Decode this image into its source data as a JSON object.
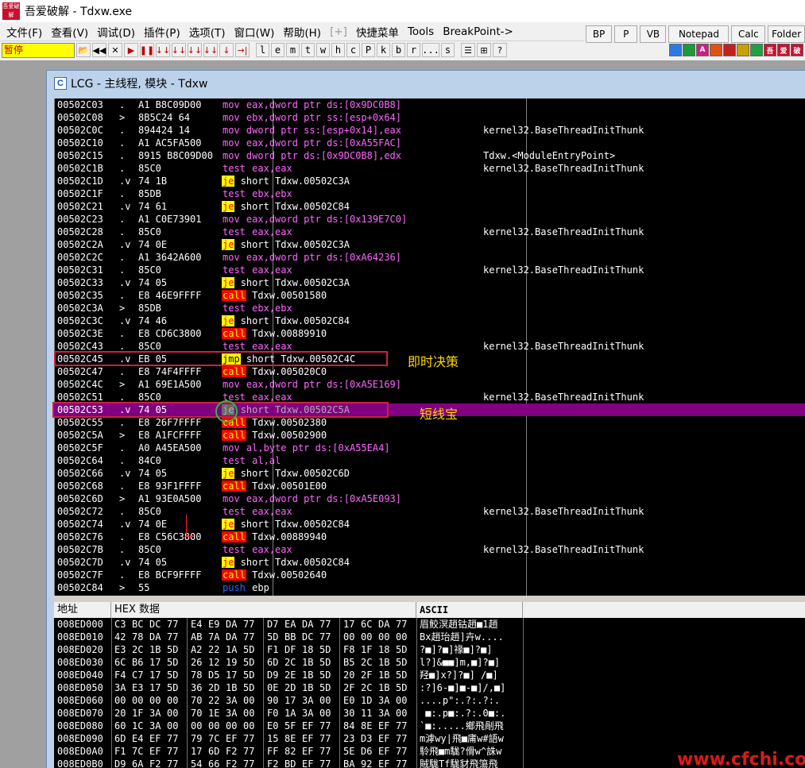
{
  "window": {
    "logo_text": "吾爱破解",
    "title": "吾爱破解 - Tdxw.exe"
  },
  "menu": [
    "文件(F)",
    "查看(V)",
    "调试(D)",
    "插件(P)",
    "选项(T)",
    "窗口(W)",
    "帮助(H)",
    "[+]",
    "快捷菜单",
    "Tools",
    "BreakPoint->"
  ],
  "quick_buttons": [
    "BP",
    "P",
    "VB",
    "Notepad",
    "Calc",
    "Folder"
  ],
  "toolbar": {
    "status": "暂停",
    "buttons": [
      "📂",
      "◀◀",
      "✕",
      "▶",
      "❚❚",
      "↓↓",
      "↓↓",
      "↓↓",
      "↓↓",
      "↓",
      "→|"
    ],
    "letters": [
      "l",
      "e",
      "m",
      "t",
      "w",
      "h",
      "c",
      "P",
      "k",
      "b",
      "r",
      "...",
      "s"
    ],
    "extra": [
      "☰",
      "⊞",
      "?"
    ],
    "color_buttons": [
      {
        "label": "",
        "color": "#2a7be0"
      },
      {
        "label": "",
        "color": "#1a9a3a"
      },
      {
        "label": "A",
        "color": "#cc2080"
      },
      {
        "label": "",
        "color": "#e05010"
      },
      {
        "label": "",
        "color": "#c02020"
      },
      {
        "label": "",
        "color": "#c8a000"
      },
      {
        "label": "",
        "color": "#20a040"
      },
      {
        "label": "吾",
        "color": "#c8102e"
      },
      {
        "label": "爱",
        "color": "#c8102e"
      },
      {
        "label": "破",
        "color": "#c8102e"
      }
    ]
  },
  "child_window": {
    "icon": "C",
    "title": "LCG - 主线程, 模块 - Tdxw"
  },
  "disasm": [
    {
      "addr": "00502C03",
      "mark": ".",
      "hex": "A1 B8C09D00",
      "op": "mov",
      "args": "eax,dword ptr ds:[0x9DC0B8]",
      "mem": true,
      "cmt": ""
    },
    {
      "addr": "00502C08",
      "mark": ">",
      "hex": "8B5C24 64",
      "op": "mov",
      "args": "ebx,dword ptr ss:[esp+0x64]",
      "mem": true,
      "cmt": ""
    },
    {
      "addr": "00502C0C",
      "mark": ".",
      "hex": "894424 14",
      "op": "mov",
      "args": "dword ptr ss:[esp+0x14],eax",
      "mem": true,
      "cmt": "kernel32.BaseThreadInitThunk"
    },
    {
      "addr": "00502C10",
      "mark": ".",
      "hex": "A1 AC5FA500",
      "op": "mov",
      "args": "eax,dword ptr ds:[0xA55FAC]",
      "mem": true,
      "cmt": ""
    },
    {
      "addr": "00502C15",
      "mark": ".",
      "hex": "8915 B8C09D00",
      "op": "mov",
      "args": "dword ptr ds:[0x9DC0B8],edx",
      "mem": true,
      "cmt": "Tdxw.<ModuleEntryPoint>"
    },
    {
      "addr": "00502C1B",
      "mark": ".",
      "hex": "85C0",
      "op": "test",
      "args": "eax,eax",
      "mem": true,
      "cmt": "kernel32.BaseThreadInitThunk"
    },
    {
      "addr": "00502C1D",
      "mark": ".v",
      "hex": "74 1B",
      "op": "je",
      "args": "short Tdxw.00502C3A",
      "mem": false,
      "cmt": ""
    },
    {
      "addr": "00502C1F",
      "mark": ".",
      "hex": "85DB",
      "op": "test",
      "args": "ebx,ebx",
      "mem": true,
      "cmt": ""
    },
    {
      "addr": "00502C21",
      "mark": ".v",
      "hex": "74 61",
      "op": "je",
      "args": "short Tdxw.00502C84",
      "mem": false,
      "cmt": ""
    },
    {
      "addr": "00502C23",
      "mark": ".",
      "hex": "A1 C0E73901",
      "op": "mov",
      "args": "eax,dword ptr ds:[0x139E7C0]",
      "mem": true,
      "cmt": ""
    },
    {
      "addr": "00502C28",
      "mark": ".",
      "hex": "85C0",
      "op": "test",
      "args": "eax,eax",
      "mem": true,
      "cmt": "kernel32.BaseThreadInitThunk"
    },
    {
      "addr": "00502C2A",
      "mark": ".v",
      "hex": "74 0E",
      "op": "je",
      "args": "short Tdxw.00502C3A",
      "mem": false,
      "cmt": ""
    },
    {
      "addr": "00502C2C",
      "mark": ".",
      "hex": "A1 3642A600",
      "op": "mov",
      "args": "eax,dword ptr ds:[0xA64236]",
      "mem": true,
      "cmt": ""
    },
    {
      "addr": "00502C31",
      "mark": ".",
      "hex": "85C0",
      "op": "test",
      "args": "eax,eax",
      "mem": true,
      "cmt": "kernel32.BaseThreadInitThunk"
    },
    {
      "addr": "00502C33",
      "mark": ".v",
      "hex": "74 05",
      "op": "je",
      "args": "short Tdxw.00502C3A",
      "mem": false,
      "cmt": ""
    },
    {
      "addr": "00502C35",
      "mark": ".",
      "hex": "E8 46E9FFFF",
      "op": "call",
      "args": "Tdxw.00501580",
      "mem": false,
      "cmt": ""
    },
    {
      "addr": "00502C3A",
      "mark": ">",
      "hex": "85DB",
      "op": "test",
      "args": "ebx,ebx",
      "mem": true,
      "cmt": ""
    },
    {
      "addr": "00502C3C",
      "mark": ".v",
      "hex": "74 46",
      "op": "je",
      "args": "short Tdxw.00502C84",
      "mem": false,
      "cmt": ""
    },
    {
      "addr": "00502C3E",
      "mark": ".",
      "hex": "E8 CD6C3800",
      "op": "call",
      "args": "Tdxw.00889910",
      "mem": false,
      "cmt": ""
    },
    {
      "addr": "00502C43",
      "mark": ".",
      "hex": "85C0",
      "op": "test",
      "args": "eax,eax",
      "mem": true,
      "cmt": "kernel32.BaseThreadInitThunk"
    },
    {
      "addr": "00502C45",
      "mark": ".v",
      "hex": "EB 05",
      "op": "jmp",
      "args": "short Tdxw.00502C4C",
      "mem": false,
      "cmt": ""
    },
    {
      "addr": "00502C47",
      "mark": ".",
      "hex": "E8 74F4FFFF",
      "op": "call",
      "args": "Tdxw.005020C0",
      "mem": false,
      "cmt": ""
    },
    {
      "addr": "00502C4C",
      "mark": ">",
      "hex": "A1 69E1A500",
      "op": "mov",
      "args": "eax,dword ptr ds:[0xA5E169]",
      "mem": true,
      "cmt": ""
    },
    {
      "addr": "00502C51",
      "mark": ".",
      "hex": "85C0",
      "op": "test",
      "args": "eax,eax",
      "mem": true,
      "cmt": "kernel32.BaseThreadInitThunk"
    },
    {
      "addr": "00502C53",
      "mark": ".v",
      "hex": "74 05",
      "op": "je",
      "args": "short Tdxw.00502C5A",
      "mem": false,
      "cmt": ""
    },
    {
      "addr": "00502C55",
      "mark": ".",
      "hex": "E8 26F7FFFF",
      "op": "call",
      "args": "Tdxw.00502380",
      "mem": false,
      "cmt": ""
    },
    {
      "addr": "00502C5A",
      "mark": ">",
      "hex": "E8 A1FCFFFF",
      "op": "call",
      "args": "Tdxw.00502900",
      "mem": false,
      "cmt": ""
    },
    {
      "addr": "00502C5F",
      "mark": ".",
      "hex": "A0 A45EA500",
      "op": "mov",
      "args": "al,byte ptr ds:[0xA55EA4]",
      "mem": true,
      "cmt": ""
    },
    {
      "addr": "00502C64",
      "mark": ".",
      "hex": "84C0",
      "op": "test",
      "args": "al,al",
      "mem": true,
      "cmt": ""
    },
    {
      "addr": "00502C66",
      "mark": ".v",
      "hex": "74 05",
      "op": "je",
      "args": "short Tdxw.00502C6D",
      "mem": false,
      "cmt": ""
    },
    {
      "addr": "00502C68",
      "mark": ".",
      "hex": "E8 93F1FFFF",
      "op": "call",
      "args": "Tdxw.00501E00",
      "mem": false,
      "cmt": ""
    },
    {
      "addr": "00502C6D",
      "mark": ">",
      "hex": "A1 93E0A500",
      "op": "mov",
      "args": "eax,dword ptr ds:[0xA5E093]",
      "mem": true,
      "cmt": ""
    },
    {
      "addr": "00502C72",
      "mark": ".",
      "hex": "85C0",
      "op": "test",
      "args": "eax,eax",
      "mem": true,
      "cmt": "kernel32.BaseThreadInitThunk"
    },
    {
      "addr": "00502C74",
      "mark": ".v",
      "hex": "74 0E",
      "op": "je",
      "args": "short Tdxw.00502C84",
      "mem": false,
      "cmt": ""
    },
    {
      "addr": "00502C76",
      "mark": ".",
      "hex": "E8 C56C3800",
      "op": "call",
      "args": "Tdxw.00889940",
      "mem": false,
      "cmt": ""
    },
    {
      "addr": "00502C7B",
      "mark": ".",
      "hex": "85C0",
      "op": "test",
      "args": "eax,eax",
      "mem": true,
      "cmt": "kernel32.BaseThreadInitThunk"
    },
    {
      "addr": "00502C7D",
      "mark": ".v",
      "hex": "74 05",
      "op": "je",
      "args": "short Tdxw.00502C84",
      "mem": false,
      "cmt": ""
    },
    {
      "addr": "00502C7F",
      "mark": ".",
      "hex": "E8 BCF9FFFF",
      "op": "call",
      "args": "Tdxw.00502640",
      "mem": false,
      "cmt": ""
    },
    {
      "addr": "00502C84",
      "mark": ">",
      "hex": "55",
      "op": "push",
      "args": "ebp",
      "mem": false,
      "cmt": ""
    }
  ],
  "selected_addr": "00502C53",
  "annotations": {
    "jmp_note": "即时决策",
    "je_note": "短线宝"
  },
  "dump_headers": [
    "地址",
    "HEX 数据",
    "ASCII"
  ],
  "dump": [
    {
      "addr": "008ED000",
      "bytes": [
        "C3",
        "BC",
        "DC",
        "77",
        "E4",
        "E9",
        "DA",
        "77",
        "D7",
        "EA",
        "DA",
        "77",
        "17",
        "6C",
        "DA",
        "77"
      ],
      "ascii": "眉鲛溟趙钴趙■1趙"
    },
    {
      "addr": "008ED010",
      "bytes": [
        "42",
        "78",
        "DA",
        "77",
        "AB",
        "7A",
        "DA",
        "77",
        "5D",
        "BB",
        "DC",
        "77",
        "00",
        "00",
        "00",
        "00"
      ],
      "ascii": "Bx趙珆趙]卉w...."
    },
    {
      "addr": "008ED020",
      "bytes": [
        "E3",
        "2C",
        "1B",
        "5D",
        "A2",
        "22",
        "1A",
        "5D",
        "F1",
        "DF",
        "18",
        "5D",
        "F8",
        "1F",
        "18",
        "5D"
      ],
      "ascii": "?■]?■]禒■]?■]"
    },
    {
      "addr": "008ED030",
      "bytes": [
        "6C",
        "B6",
        "17",
        "5D",
        "26",
        "12",
        "19",
        "5D",
        "6D",
        "2C",
        "1B",
        "5D",
        "B5",
        "2C",
        "1B",
        "5D"
      ],
      "ascii": "l?]&■■]m,■]?■]"
    },
    {
      "addr": "008ED040",
      "bytes": [
        "F4",
        "C7",
        "17",
        "5D",
        "78",
        "D5",
        "17",
        "5D",
        "D9",
        "2E",
        "1B",
        "5D",
        "20",
        "2F",
        "1B",
        "5D"
      ],
      "ascii": "羟■]x?]?■] /■]"
    },
    {
      "addr": "008ED050",
      "bytes": [
        "3A",
        "E3",
        "17",
        "5D",
        "36",
        "2D",
        "1B",
        "5D",
        "0E",
        "2D",
        "1B",
        "5D",
        "2F",
        "2C",
        "1B",
        "5D"
      ],
      "ascii": ":?]6-■]■-■]/,■]"
    },
    {
      "addr": "008ED060",
      "bytes": [
        "00",
        "00",
        "00",
        "00",
        "70",
        "22",
        "3A",
        "00",
        "90",
        "17",
        "3A",
        "00",
        "E0",
        "1D",
        "3A",
        "00"
      ],
      "ascii": "....p\":.?:.?:."
    },
    {
      "addr": "008ED070",
      "bytes": [
        "20",
        "1F",
        "3A",
        "00",
        "70",
        "1E",
        "3A",
        "00",
        "F0",
        "1A",
        "3A",
        "00",
        "30",
        "11",
        "3A",
        "00"
      ],
      "ascii": " ■:.p■:.?:.0■:."
    },
    {
      "addr": "008ED080",
      "bytes": [
        "60",
        "1C",
        "3A",
        "00",
        "00",
        "00",
        "00",
        "00",
        "E0",
        "5F",
        "EF",
        "77",
        "84",
        "8E",
        "EF",
        "77"
      ],
      "ascii": "`■:.....鄉飛剮飛"
    },
    {
      "addr": "008ED090",
      "bytes": [
        "6D",
        "E4",
        "EF",
        "77",
        "79",
        "7C",
        "EF",
        "77",
        "15",
        "8E",
        "EF",
        "77",
        "23",
        "D3",
        "EF",
        "77"
      ],
      "ascii": "m滹wy|飛■庯w#語w"
    },
    {
      "addr": "008ED0A0",
      "bytes": [
        "F1",
        "7C",
        "EF",
        "77",
        "17",
        "6D",
        "F2",
        "77",
        "FF",
        "82",
        "EF",
        "77",
        "5E",
        "D6",
        "EF",
        "77"
      ],
      "ascii": "駖飛■m駹?傦w^誅w"
    },
    {
      "addr": "008ED0B0",
      "bytes": [
        "D9",
        "6A",
        "F2",
        "77",
        "54",
        "66",
        "F2",
        "77",
        "F2",
        "BD",
        "EF",
        "77",
        "BA",
        "92",
        "EF",
        "77"
      ],
      "ascii": "賊駹Tf駹豺飛簜飛"
    }
  ],
  "watermark": "www.cfchi.com"
}
